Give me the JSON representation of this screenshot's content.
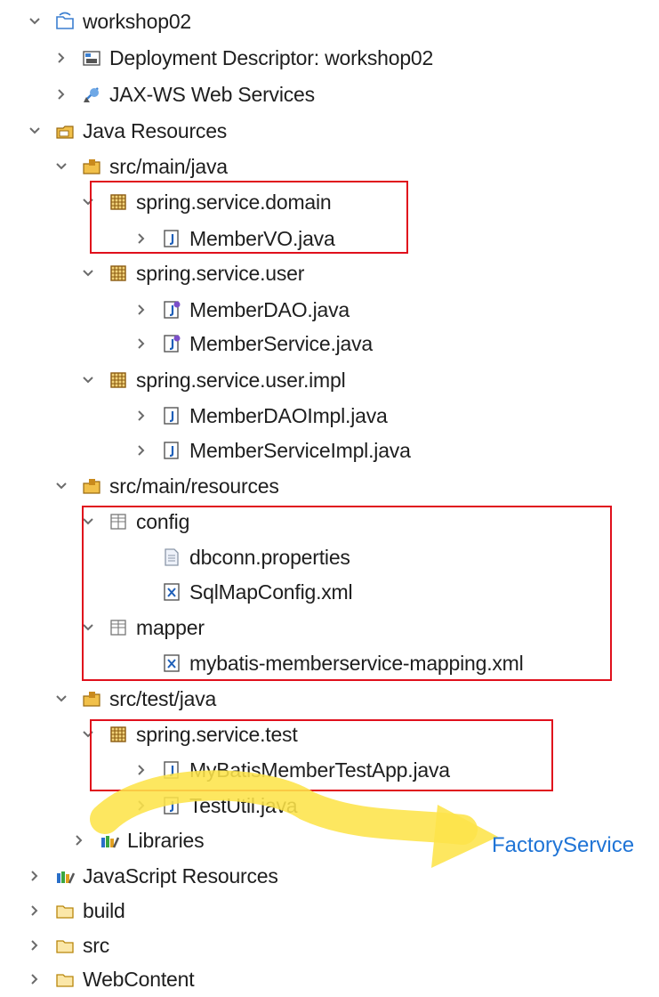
{
  "tree": [
    {
      "label": "workshop02",
      "icon": "project-icon",
      "expanded": true
    },
    {
      "label": "Deployment Descriptor: workshop02",
      "icon": "deployment-descriptor-icon",
      "expanded": false
    },
    {
      "label": "JAX-WS Web Services",
      "icon": "web-services-icon",
      "expanded": false
    },
    {
      "label": "Java Resources",
      "icon": "java-resources-icon",
      "expanded": true
    },
    {
      "label": "src/main/java",
      "icon": "source-folder-icon",
      "expanded": true
    },
    {
      "label": "spring.service.domain",
      "icon": "package-icon",
      "expanded": true
    },
    {
      "label": "MemberVO.java",
      "icon": "java-class-icon",
      "expanded": false
    },
    {
      "label": "spring.service.user",
      "icon": "package-icon",
      "expanded": true
    },
    {
      "label": "MemberDAO.java",
      "icon": "java-interface-icon",
      "expanded": false
    },
    {
      "label": "MemberService.java",
      "icon": "java-interface-icon",
      "expanded": false
    },
    {
      "label": "spring.service.user.impl",
      "icon": "package-icon",
      "expanded": true
    },
    {
      "label": "MemberDAOImpl.java",
      "icon": "java-class-icon",
      "expanded": false
    },
    {
      "label": "MemberServiceImpl.java",
      "icon": "java-class-icon",
      "expanded": false
    },
    {
      "label": "src/main/resources",
      "icon": "source-folder-icon",
      "expanded": true
    },
    {
      "label": "config",
      "icon": "resource-folder-icon",
      "expanded": true
    },
    {
      "label": "dbconn.properties",
      "icon": "properties-file-icon",
      "expanded": null
    },
    {
      "label": "SqlMapConfig.xml",
      "icon": "xml-file-icon",
      "expanded": null
    },
    {
      "label": "mapper",
      "icon": "resource-folder-icon",
      "expanded": true
    },
    {
      "label": "mybatis-memberservice-mapping.xml",
      "icon": "xml-file-icon",
      "expanded": null
    },
    {
      "label": "src/test/java",
      "icon": "source-folder-icon",
      "expanded": true
    },
    {
      "label": "spring.service.test",
      "icon": "package-icon",
      "expanded": true
    },
    {
      "label": "MyBatisMemberTestApp.java",
      "icon": "java-class-icon",
      "expanded": false
    },
    {
      "label": "TestUtil.java",
      "icon": "java-class-icon",
      "expanded": false
    },
    {
      "label": "Libraries",
      "icon": "libraries-icon",
      "expanded": false
    },
    {
      "label": "JavaScript Resources",
      "icon": "libraries-icon",
      "expanded": false
    },
    {
      "label": "build",
      "icon": "folder-icon",
      "expanded": false
    },
    {
      "label": "src",
      "icon": "folder-icon",
      "expanded": false
    },
    {
      "label": "WebContent",
      "icon": "folder-icon",
      "expanded": false
    }
  ],
  "annotation": {
    "text": "FactoryService"
  },
  "colors": {
    "highlight_box": "#e0101c",
    "annotation_text": "#1f74d6",
    "arrow": "#fde44a",
    "chevron": "#6b6b6b"
  }
}
